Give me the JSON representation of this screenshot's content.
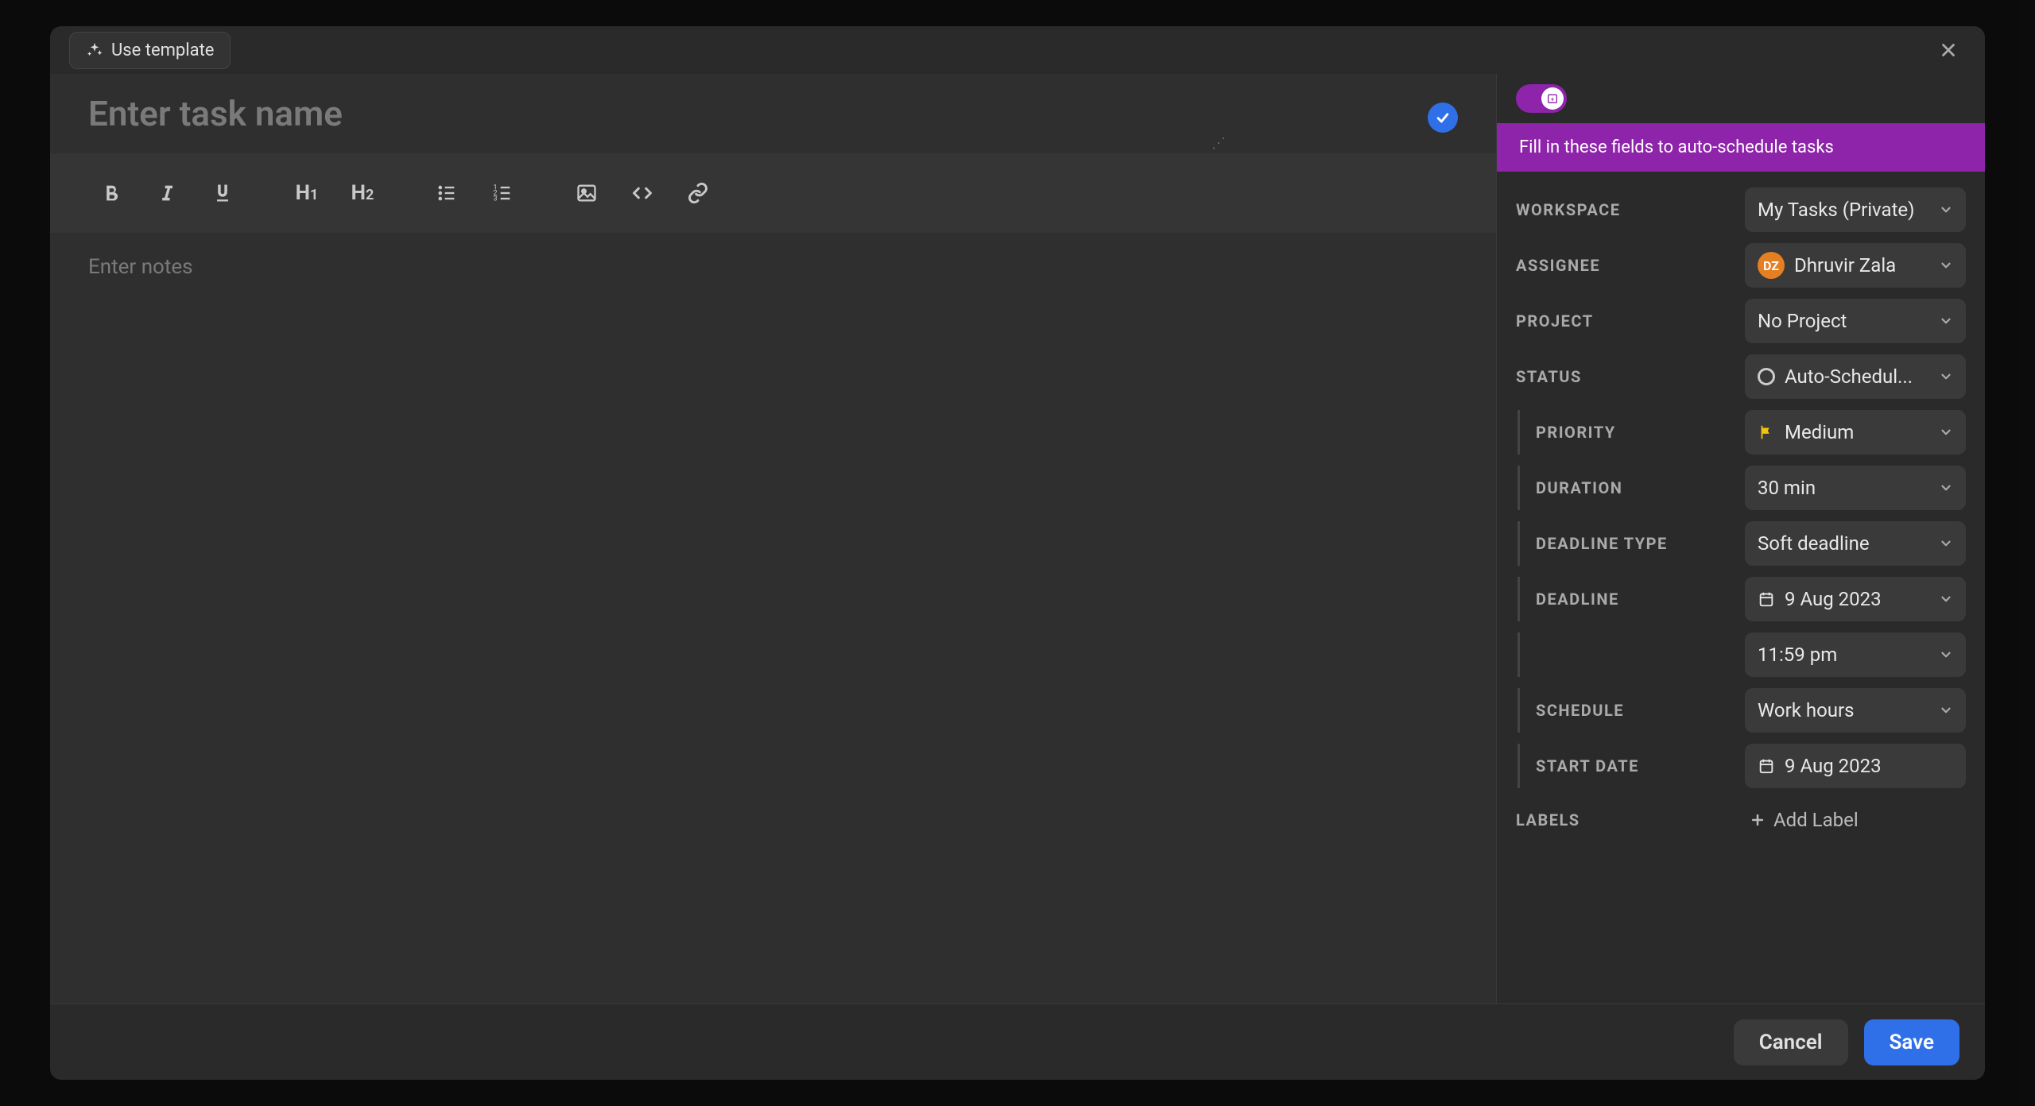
{
  "buttons": {
    "use_template": "Use template",
    "cancel": "Cancel",
    "save": "Save",
    "add_label": "Add Label"
  },
  "placeholders": {
    "task_title": "Enter task name",
    "notes": "Enter notes"
  },
  "banner": {
    "text": "Fill in these fields to auto-schedule tasks"
  },
  "fields": {
    "workspace": {
      "label": "Workspace",
      "value": "My Tasks (Private)"
    },
    "assignee": {
      "label": "Assignee",
      "value": "Dhruvir Zala",
      "initials": "DZ"
    },
    "project": {
      "label": "Project",
      "value": "No Project"
    },
    "status": {
      "label": "Status",
      "value": "Auto-Schedul..."
    },
    "priority": {
      "label": "Priority",
      "value": "Medium"
    },
    "duration": {
      "label": "Duration",
      "value": "30 min"
    },
    "deadline_type": {
      "label": "Deadline Type",
      "value": "Soft deadline"
    },
    "deadline": {
      "label": "Deadline",
      "value": "9 Aug 2023",
      "time": "11:59 pm"
    },
    "schedule": {
      "label": "Schedule",
      "value": "Work hours"
    },
    "start_date": {
      "label": "Start Date",
      "value": "9 Aug 2023"
    },
    "labels": {
      "label": "Labels"
    }
  }
}
